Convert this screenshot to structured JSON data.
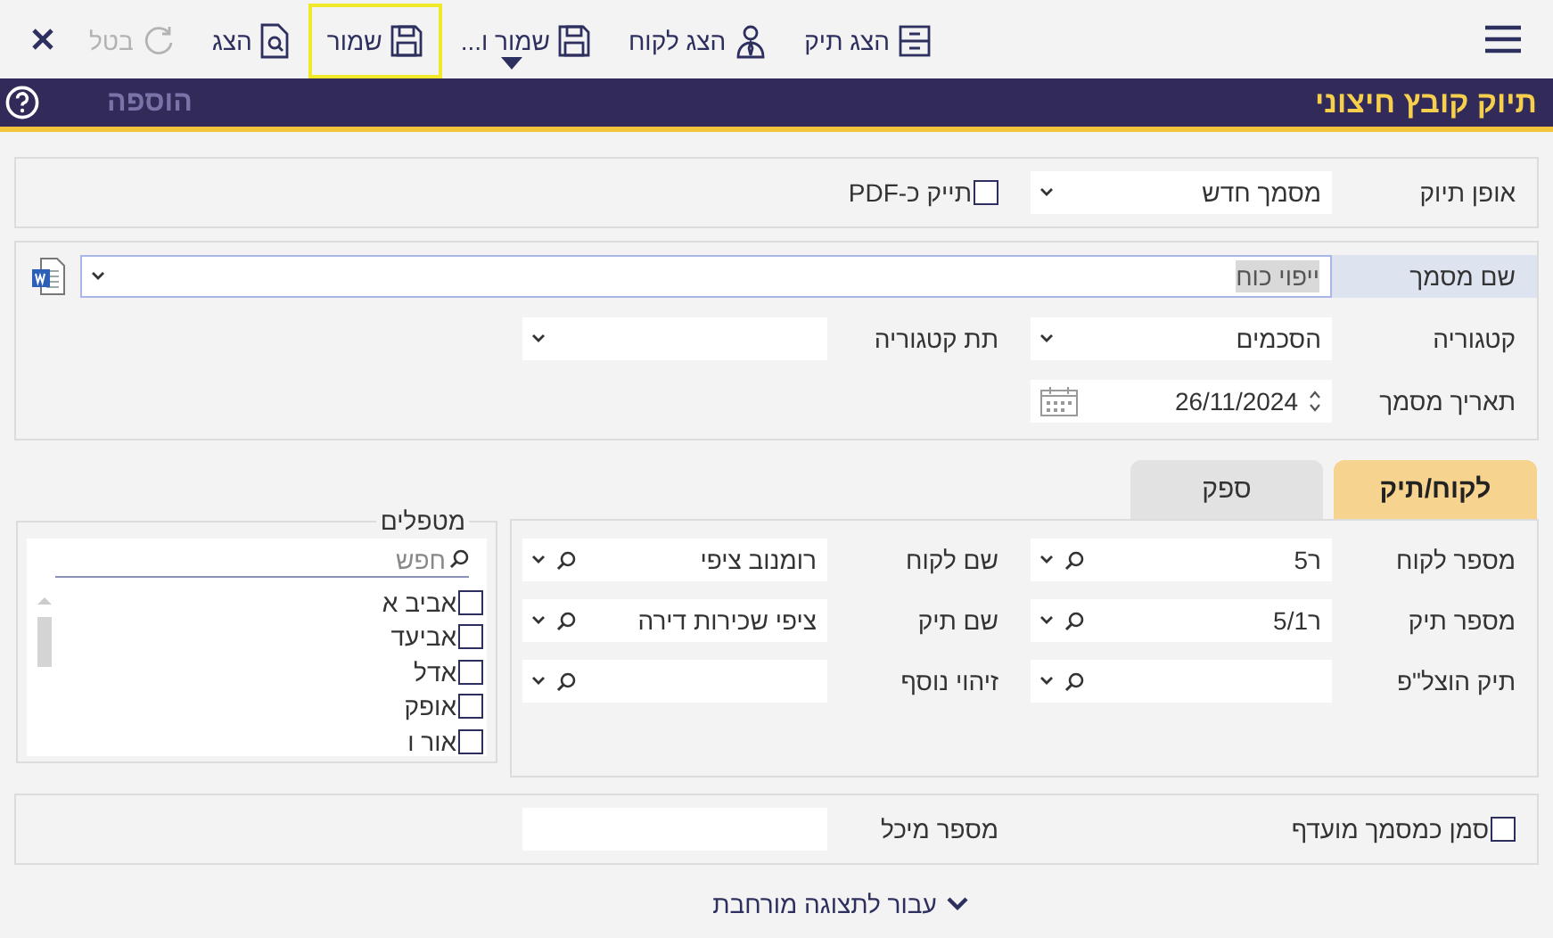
{
  "toolbar": [
    {
      "label": "הצג תיק",
      "kind": "button",
      "disabled": false,
      "focused": false
    },
    {
      "label": "הצג לקוח",
      "kind": "button",
      "disabled": false,
      "focused": false
    },
    {
      "label": "שמור ו...",
      "kind": "split",
      "disabled": false,
      "focused": false
    },
    {
      "label": "שמור",
      "kind": "button",
      "disabled": false,
      "focused": true
    },
    {
      "label": "הצג",
      "kind": "button",
      "disabled": false,
      "focused": false
    },
    {
      "label": "בטל",
      "kind": "button",
      "disabled": true,
      "focused": false
    }
  ],
  "title_bar": {
    "title": "תיוק קובץ חיצוני",
    "add_button": {
      "label": "הוספה",
      "disabled": true
    }
  },
  "filing": {
    "method": {
      "label": "אופן תיוק",
      "value": "מסמך חדש"
    },
    "pdf_checkbox": {
      "label": "תייק כ-PDF",
      "checked": false
    }
  },
  "document": {
    "name": {
      "label": "שם מסמך",
      "value": "ייפוי כוח"
    },
    "category": {
      "label": "קטגוריה",
      "value": "הסכמים"
    },
    "subcategory": {
      "label": "תת קטגוריה"
    },
    "date": {
      "label": "תאריך מסמך",
      "value": "26/11/2024"
    }
  },
  "tabs": [
    {
      "label": "לקוח/תיק",
      "selected": true
    },
    {
      "label": "ספק",
      "selected": false
    }
  ],
  "client_fields": [
    {
      "label": "מספר לקוח",
      "value": "ר5"
    },
    {
      "label": "שם לקוח",
      "value": "רומנוב ציפי"
    },
    {
      "label": "מספר תיק",
      "value": "ר5/1"
    },
    {
      "label": "שם תיק",
      "value": "ציפי שכירות דירה"
    },
    {
      "label": "תיק הוצל\"פ"
    },
    {
      "label": "זיהוי נוסף"
    }
  ],
  "handlers": {
    "legend": "מטפלים",
    "search": {
      "placeholder": "חפש"
    },
    "items": [
      {
        "label": "אביב א",
        "checked": false
      },
      {
        "label": "אביעד",
        "checked": false
      },
      {
        "label": "אדל",
        "checked": false
      },
      {
        "label": "אופק",
        "checked": false
      },
      {
        "label": "אור ו",
        "checked": false
      }
    ]
  },
  "extra": {
    "favorite_checkbox": {
      "label": "סמן כמסמך מועדף",
      "checked": false
    },
    "container_number": {
      "label": "מספר מיכל"
    }
  },
  "expand_link": "עבור לתצוגה מורחבת"
}
